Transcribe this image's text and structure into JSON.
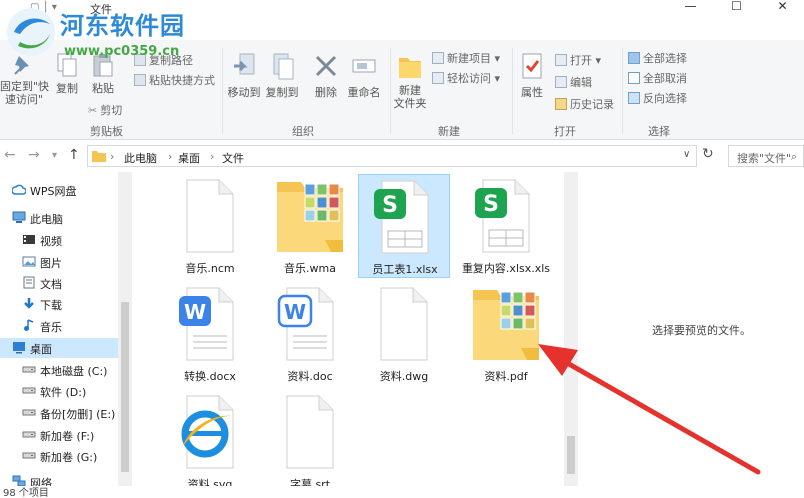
{
  "window": {
    "title": "文件"
  },
  "watermark": {
    "site_name": "河东软件园",
    "url": "www.pc0359.cn"
  },
  "ribbon": {
    "clipboard": {
      "pin_label": "固定到\"快\n速访问\"",
      "copy_label": "复制",
      "paste_label": "粘贴",
      "copy_path_label": "复制路径",
      "paste_shortcut_label": "粘贴快捷方式",
      "cut_label": "剪切",
      "group_label": "剪贴板"
    },
    "organize": {
      "move_to_label": "移动到",
      "copy_to_label": "复制到",
      "delete_label": "删除",
      "rename_label": "重命名",
      "group_label": "组织"
    },
    "new": {
      "new_folder_label": "新建\n文件夹",
      "new_item_label": "新建项目",
      "easy_access_label": "轻松访问",
      "group_label": "新建"
    },
    "open": {
      "properties_label": "属性",
      "open_label": "打开",
      "edit_label": "编辑",
      "history_label": "历史记录",
      "group_label": "打开"
    },
    "select": {
      "select_all_label": "全部选择",
      "select_none_label": "全部取消",
      "invert_label": "反向选择",
      "group_label": "选择"
    }
  },
  "address": {
    "crumbs": [
      "此电脑",
      "桌面",
      "文件"
    ],
    "search_placeholder": "搜索\"文件\""
  },
  "nav": [
    {
      "label": "WPS网盘",
      "icon": "cloud-icon"
    },
    {
      "label": "此电脑",
      "icon": "computer-icon"
    },
    {
      "label": "视频",
      "icon": "video-folder-icon"
    },
    {
      "label": "图片",
      "icon": "pictures-folder-icon"
    },
    {
      "label": "文档",
      "icon": "documents-folder-icon"
    },
    {
      "label": "下载",
      "icon": "download-icon"
    },
    {
      "label": "音乐",
      "icon": "music-icon"
    },
    {
      "label": "桌面",
      "icon": "desktop-icon",
      "selected": true
    },
    {
      "label": "本地磁盘 (C:)",
      "icon": "drive-icon"
    },
    {
      "label": "软件 (D:)",
      "icon": "drive-icon"
    },
    {
      "label": "备份[勿删] (E:)",
      "icon": "drive-icon"
    },
    {
      "label": "新加卷 (F:)",
      "icon": "drive-icon"
    },
    {
      "label": "新加卷 (G:)",
      "icon": "drive-icon"
    },
    {
      "label": "网络",
      "icon": "network-icon"
    }
  ],
  "files": [
    {
      "name": "音乐.ncm",
      "type": "blank"
    },
    {
      "name": "音乐.wma",
      "type": "photo-folder"
    },
    {
      "name": "员工表1.xlsx",
      "type": "sheet",
      "selected": true
    },
    {
      "name": "重复内容.xlsx.xls",
      "type": "sheet"
    },
    {
      "name": "转换.docx",
      "type": "word"
    },
    {
      "name": "资料.doc",
      "type": "word-outline"
    },
    {
      "name": "资料.dwg",
      "type": "blank"
    },
    {
      "name": "资料.pdf",
      "type": "photo-folder"
    },
    {
      "name": "资料.svg",
      "type": "ie"
    },
    {
      "name": "字幕.srt",
      "type": "blank"
    }
  ],
  "preview": {
    "message": "选择要预览的文件。"
  },
  "status": {
    "count": "98 个项目"
  },
  "colors": {
    "accent": "#0078d7",
    "selection": "#cce8ff",
    "arrow": "#e5322d"
  }
}
